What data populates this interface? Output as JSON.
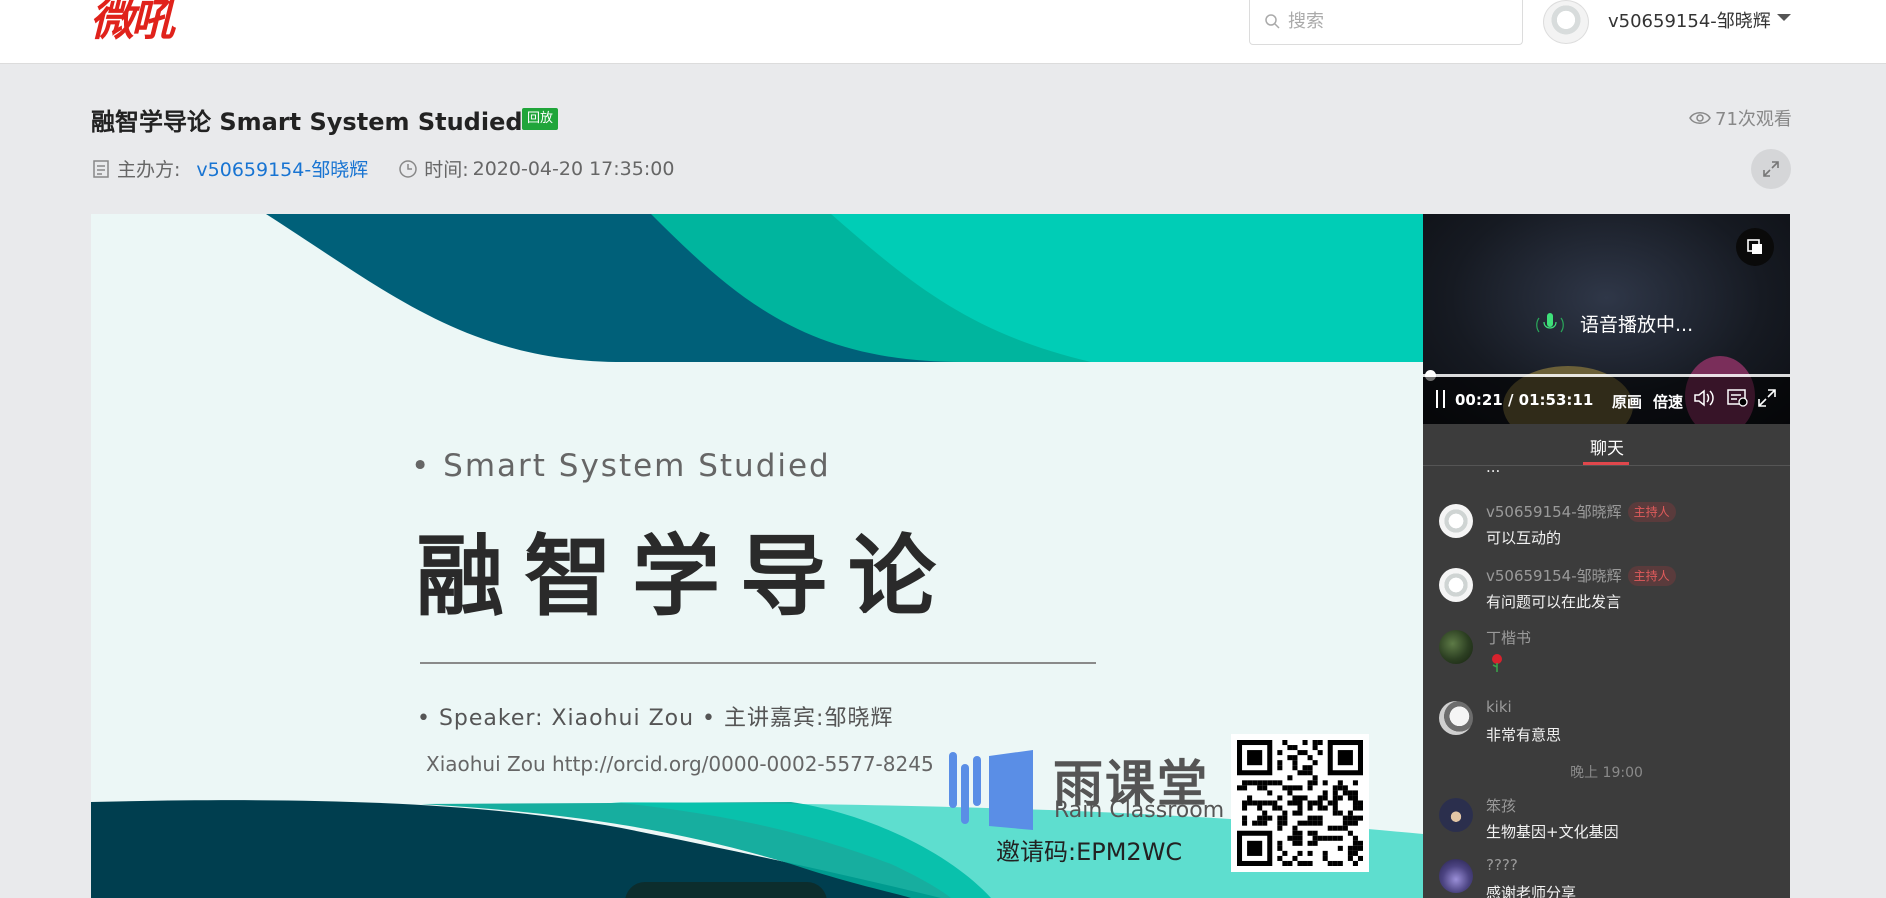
{
  "header": {
    "logo": "微吼",
    "search_placeholder": "搜索",
    "user_name": "v50659154-邹晓辉"
  },
  "event": {
    "title": "融智学导论 Smart System Studied",
    "badge": "回放",
    "views": "71次观看",
    "host_label": "主办方:",
    "host_name": "v50659154-邹晓辉",
    "time_label": "时间:",
    "time_value": "2020-04-20 17:35:00"
  },
  "slide": {
    "subtitle": "• Smart System Studied",
    "title": "融智学导论",
    "speaker": "•  Speaker: Xiaohui Zou •  主讲嘉宾:邹晓辉",
    "orcid": "Xiaohui Zou http://orcid.org/0000-0002-5577-8245",
    "brand_cn": "雨课堂",
    "brand_en": "Rain Classroom",
    "invite": "邀请码:EPM2WC"
  },
  "player": {
    "status": "语音播放中...",
    "time": "00:21 / 01:53:11",
    "original_label": "原画",
    "speed_label": "倍速",
    "progress": 0.003
  },
  "chat": {
    "tab_label": "聊天",
    "cut_text": "...",
    "messages": [
      {
        "name": "v50659154-邹晓辉",
        "role": "主持人",
        "text": "可以互动的"
      },
      {
        "name": "v50659154-邹晓辉",
        "role": "主持人",
        "text": "有问题可以在此发言"
      },
      {
        "name": "丁楷书",
        "role": "",
        "text": ""
      },
      {
        "name": "kiki",
        "role": "",
        "text": "非常有意思"
      },
      {
        "name": "笨孩",
        "role": "",
        "text": "生物基因+文化基因"
      },
      {
        "name": "????",
        "role": "",
        "text": "感谢老师分享"
      }
    ],
    "time_separator": "晚上 19:00"
  },
  "colors": {
    "brand_red": "#e0221b",
    "replay_green": "#20a53a",
    "link_blue": "#1874d2",
    "host_tag_red": "#e05b5b",
    "chat_tab_accent": "#e0474c"
  }
}
